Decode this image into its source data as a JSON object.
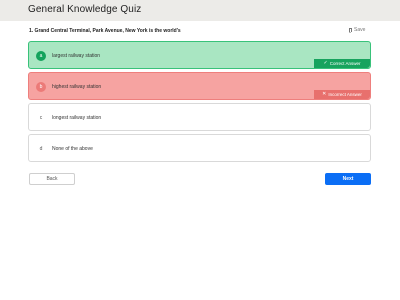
{
  "header": {
    "title": "General Knowledge Quiz"
  },
  "question": {
    "text": "1. Grand Central Terminal, Park Avenue, New York is the world's"
  },
  "actions": {
    "save_label": "Save",
    "back_label": "Back",
    "next_label": "Next"
  },
  "options": [
    {
      "letter": "a",
      "text": "largest railway station",
      "state": "correct",
      "badge": "Correct Answer"
    },
    {
      "letter": "b",
      "text": "highest railway station",
      "state": "incorrect",
      "badge": "Incorrect Answer"
    },
    {
      "letter": "c",
      "text": "longest railway station",
      "state": "neutral"
    },
    {
      "letter": "d",
      "text": "None of the above",
      "state": "neutral"
    }
  ],
  "colors": {
    "correct": "#17a35e",
    "incorrect": "#e8706d",
    "primary": "#0b6ef5"
  }
}
